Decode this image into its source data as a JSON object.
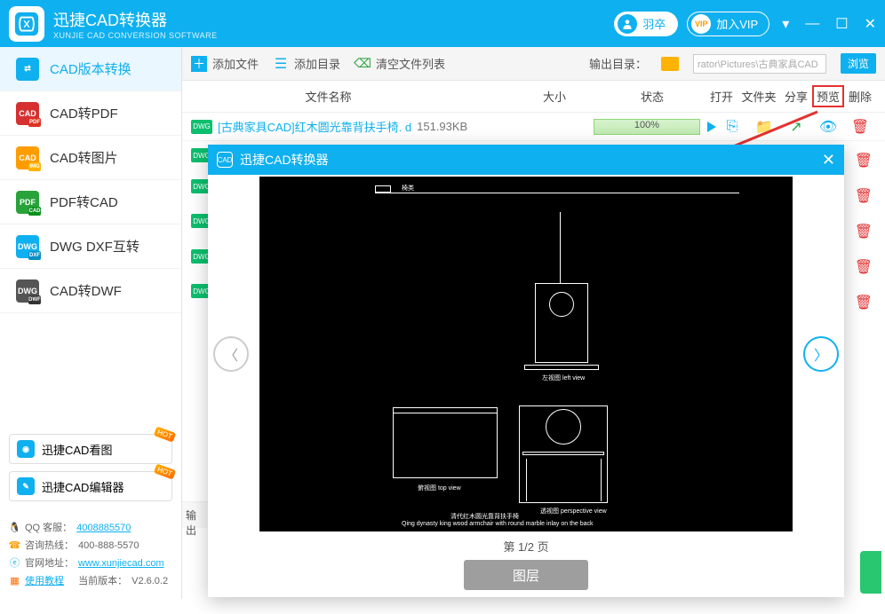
{
  "titlebar": {
    "app_name": "迅捷CAD转换器",
    "app_sub": "XUNJIE CAD CONVERSION SOFTWARE",
    "user": "羽卒",
    "vip_badge": "VIP",
    "vip_label": "加入VIP"
  },
  "sidebar": {
    "items": [
      {
        "label": "CAD版本转换"
      },
      {
        "label": "CAD转PDF"
      },
      {
        "label": "CAD转图片"
      },
      {
        "label": "PDF转CAD"
      },
      {
        "label": "DWG DXF互转"
      },
      {
        "label": "CAD转DWF"
      }
    ],
    "promo1": "迅捷CAD看图",
    "promo2": "迅捷CAD编辑器",
    "hot": "HOT"
  },
  "footer": {
    "qq_label": "QQ 客服：",
    "qq_link": "4008885570",
    "hotline_label": "咨询热线：",
    "hotline_val": "400-888-5570",
    "site_label": "官网地址：",
    "site_link": "www.xunjiecad.com",
    "tutorial": "使用教程",
    "ver_label": "当前版本：",
    "ver_val": "V2.6.0.2"
  },
  "toolbar": {
    "add_file": "添加文件",
    "add_dir": "添加目录",
    "clear": "清空文件列表",
    "out_label": "输出目录：",
    "out_path": "rator\\Pictures\\古典家具CAD",
    "browse": "浏览"
  },
  "columns": {
    "name": "文件名称",
    "size": "大小",
    "status": "状态",
    "open": "打开",
    "folder": "文件夹",
    "share": "分享",
    "preview": "预览",
    "delete": "删除"
  },
  "file_row": {
    "badge": "DWG",
    "name": "[古典家具CAD]红木圆光靠背扶手椅. d",
    "size": "151.93KB",
    "progress": "100%"
  },
  "preview": {
    "title": "迅捷CAD转换器",
    "pager": "第 1/2 页",
    "layer": "图层",
    "left_view": "左视图  left view",
    "top_view": "俯视图  top view",
    "persp_view": "透视图  perspective view",
    "caption": "Qing dynasty king wood armchair with round marble inlay on the back",
    "caption_cn": "清代红木圆光靠背扶手椅"
  },
  "truncated_output": "输出"
}
